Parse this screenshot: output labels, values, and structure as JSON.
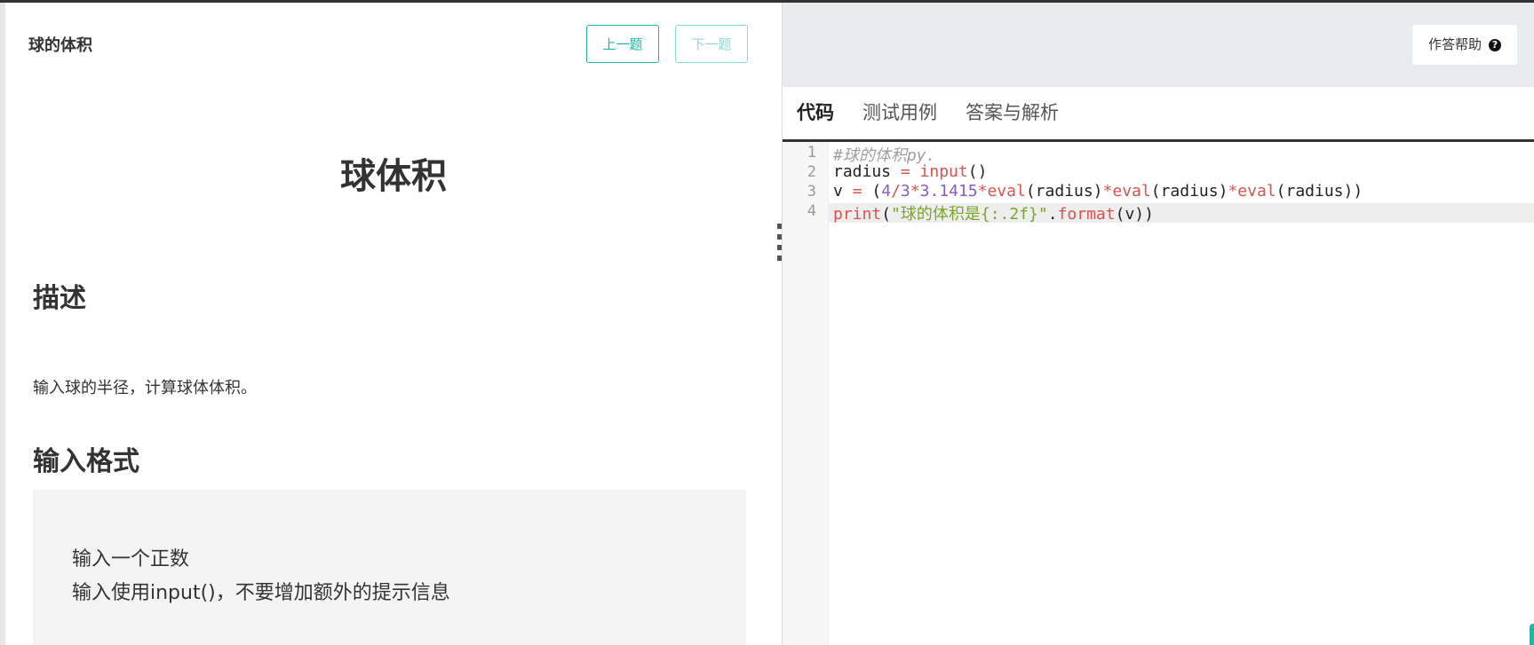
{
  "problem": {
    "title": "球的体积",
    "prev_label": "上一题",
    "next_label": "下一题",
    "heading": "球体积",
    "desc_heading": "描述",
    "desc_text": "输入球的半径，计算球体体积。",
    "input_heading": "输入格式",
    "input_lines": [
      "输入一个正数",
      "输入使用input()，不要增加额外的提示信息"
    ]
  },
  "editor_panel": {
    "help_label": "作答帮助",
    "tabs": [
      {
        "label": "代码",
        "active": true
      },
      {
        "label": "测试用例",
        "active": false
      },
      {
        "label": "答案与解析",
        "active": false
      }
    ],
    "line_numbers": [
      "1",
      "2",
      "3",
      "4"
    ],
    "code_lines": [
      "#球的体积py.",
      "radius = input()",
      "v = (4/3*3.1415*eval(radius)*eval(radius)*eval(radius))",
      "print(\"球的体积是{:.2f}\".format(v))"
    ]
  },
  "colors": {
    "accent": "#1fb6a5",
    "keyword": "#d9534f",
    "number": "#8e5ac5",
    "string": "#7aa52a"
  }
}
